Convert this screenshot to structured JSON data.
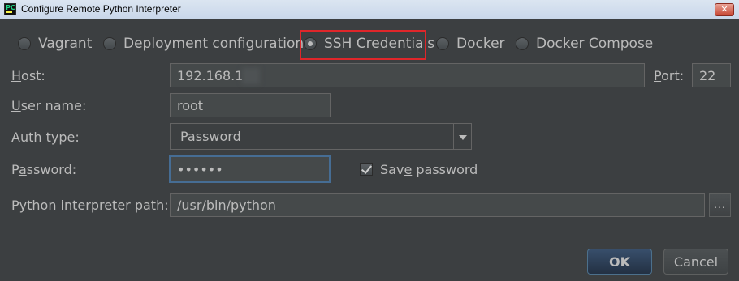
{
  "window": {
    "title": "Configure Remote Python Interpreter"
  },
  "radios": [
    {
      "label": "Vagrant",
      "selected": false
    },
    {
      "label": "Deployment configuration",
      "selected": false
    },
    {
      "label": "SSH Credentials",
      "selected": true
    },
    {
      "label": "Docker",
      "selected": false
    },
    {
      "label": "Docker Compose",
      "selected": false
    }
  ],
  "form": {
    "host_label": "Host:",
    "host_value": "192.168.1",
    "port_label": "Port:",
    "port_value": "22",
    "username_label": "User name:",
    "username_value": "root",
    "authtype_label": "Auth type:",
    "authtype_value": "Password",
    "password_label": "Password:",
    "password_value": "••••••",
    "save_password_label": "Save password",
    "save_password_checked": true,
    "interpreter_label": "Python interpreter path:",
    "interpreter_value": "/usr/bin/python",
    "browse_label": "..."
  },
  "buttons": {
    "ok": "OK",
    "cancel": "Cancel"
  },
  "colors": {
    "background": "#3c3f41",
    "highlight": "#e0262a",
    "focus": "#466d94"
  }
}
